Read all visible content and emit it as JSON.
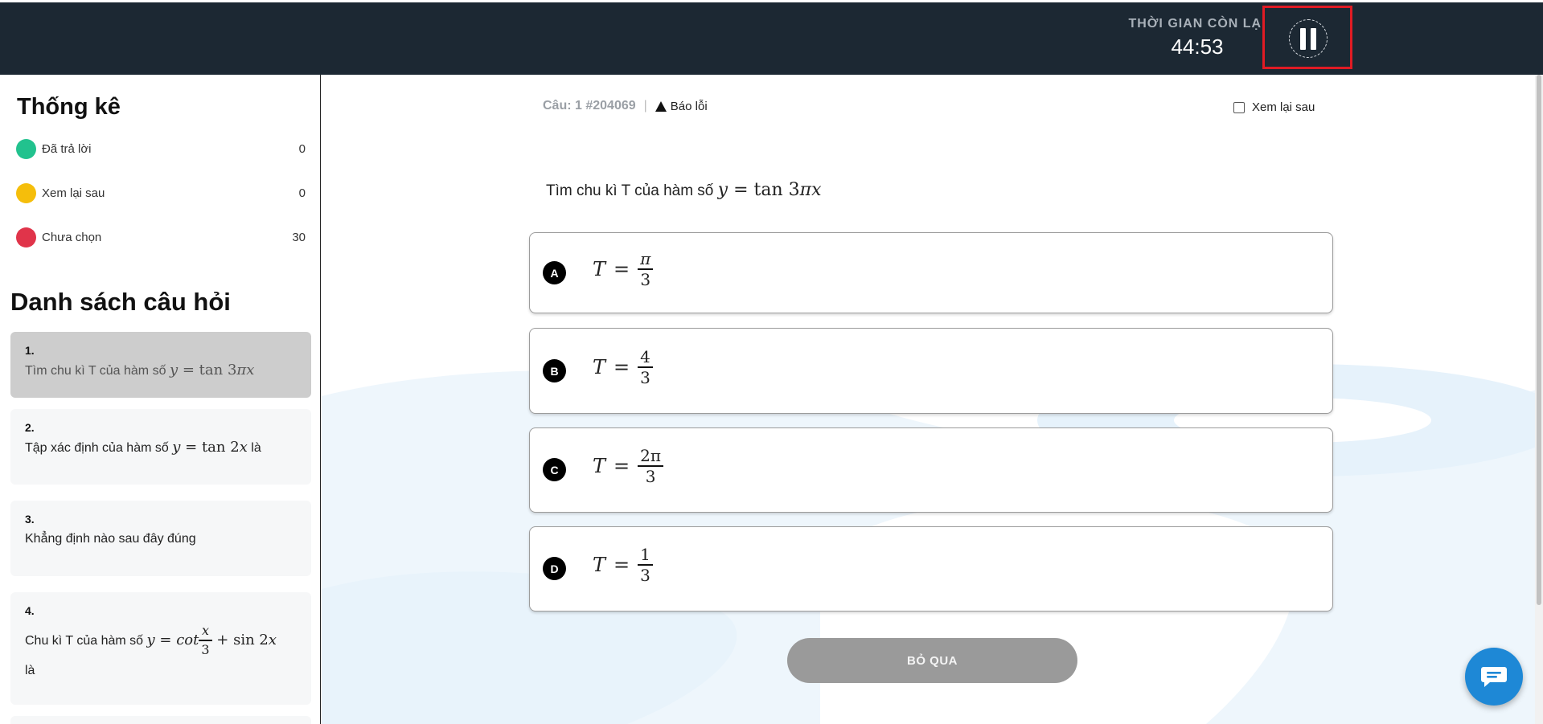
{
  "header": {
    "timer_label": "THỜI GIAN CÒN LẠI",
    "timer_value": "44:53",
    "pause_icon": "pause-icon"
  },
  "stats": {
    "title": "Thống kê",
    "items": [
      {
        "label": "Đã trả lời",
        "count": "0",
        "color": "#22c28e"
      },
      {
        "label": "Xem lại sau",
        "count": "0",
        "color": "#f5be0b"
      },
      {
        "label": "Chưa chọn",
        "count": "30",
        "color": "#e0344a"
      }
    ]
  },
  "question_list": {
    "title": "Danh sách câu hỏi",
    "items": [
      {
        "num": "1.",
        "text": "Tìm chu kì T của hàm số",
        "math": "y = tan 3πx",
        "suffix": ""
      },
      {
        "num": "2.",
        "text": "Tập xác định của hàm số",
        "math": "y = tan 2x",
        "suffix": "là"
      },
      {
        "num": "3.",
        "text": "Khẳng định nào sau đây đúng",
        "math": "",
        "suffix": ""
      },
      {
        "num": "4.",
        "text": "Chu kì T của hàm số",
        "math": "y = cot x/3 + sin 2x",
        "suffix": "là"
      }
    ]
  },
  "question": {
    "number": "Câu: 1 #204069",
    "report_label": "Báo lỗi",
    "review_label": "Xem lại sau",
    "text": "Tìm chu kì T của hàm số",
    "math": "y = tan 3πx",
    "options": [
      {
        "letter": "A",
        "var": "T",
        "num": "π",
        "den": "3"
      },
      {
        "letter": "B",
        "var": "T",
        "num": "4",
        "den": "3"
      },
      {
        "letter": "C",
        "var": "T",
        "num": "2π",
        "den": "3"
      },
      {
        "letter": "D",
        "var": "T",
        "num": "1",
        "den": "3"
      }
    ],
    "skip_label": "BỎ QUA"
  },
  "colors": {
    "header_bg": "#1c2833",
    "highlight": "#e01b24",
    "chat": "#1e88d6"
  }
}
